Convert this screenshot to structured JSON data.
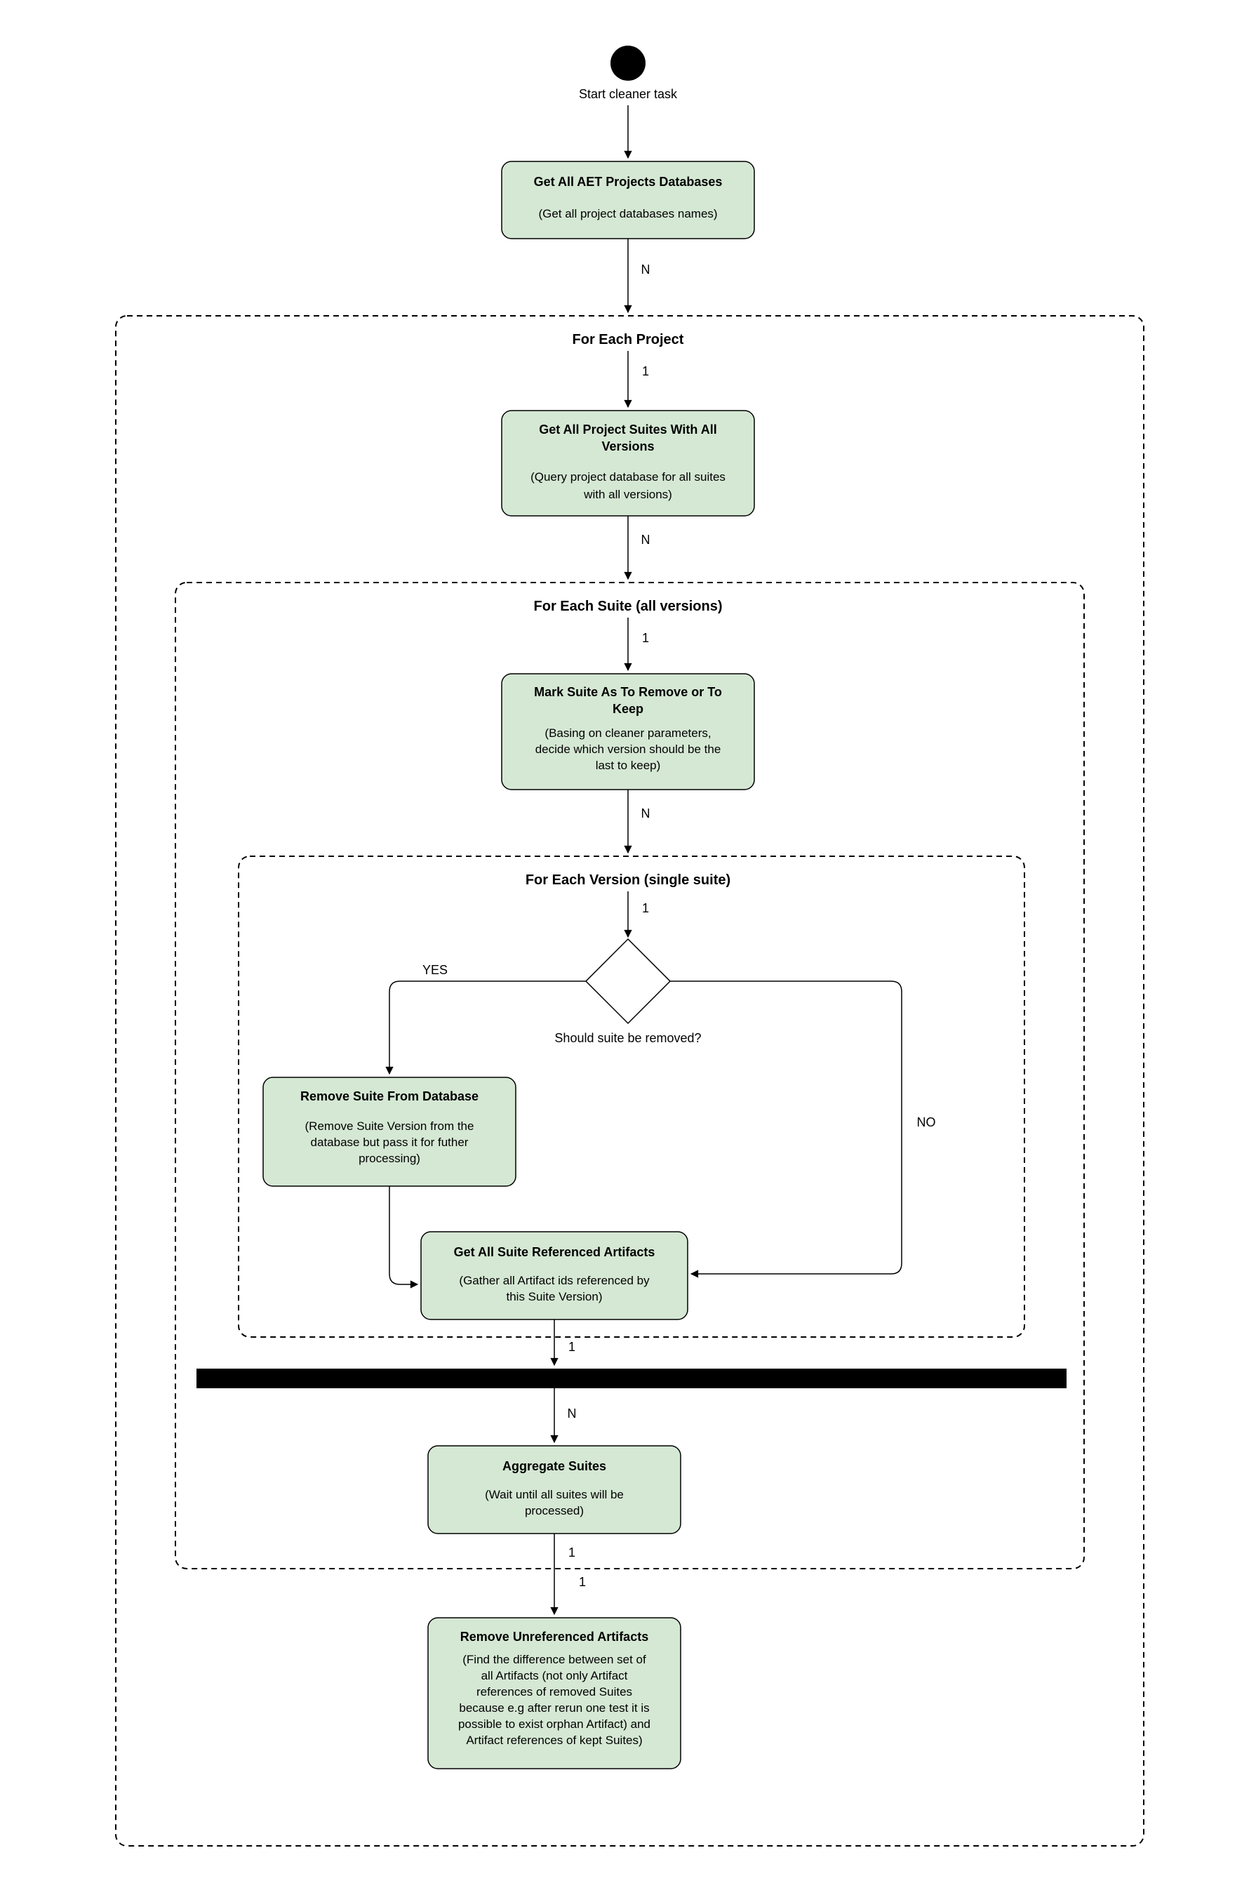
{
  "start_label": "Start cleaner task",
  "n1": {
    "title": "Get All AET Projects Databases",
    "desc": "(Get all project databases names)"
  },
  "region1_title": "For Each Project",
  "n2": {
    "title1": "Get All Project Suites With All",
    "title2": "Versions",
    "desc1": "(Query project database for all suites",
    "desc2": "with all versions)"
  },
  "region2_title": "For Each Suite (all versions)",
  "n3": {
    "title1": "Mark Suite As To Remove or To",
    "title2": "Keep",
    "desc1": "(Basing on cleaner parameters,",
    "desc2": "decide which version should be the",
    "desc3": "last to keep)"
  },
  "region3_title": "For Each Version (single suite)",
  "decision": "Should suite be removed?",
  "yes_label": "YES",
  "no_label": "NO",
  "n4": {
    "title": "Remove Suite From Database",
    "desc1": "(Remove Suite Version from the",
    "desc2": "database but pass it for futher",
    "desc3": "processing)"
  },
  "n5": {
    "title": "Get All Suite Referenced Artifacts",
    "desc1": "(Gather all Artifact ids referenced by",
    "desc2": "this Suite Version)"
  },
  "n6": {
    "title": "Aggregate Suites",
    "desc1": "(Wait until all suites will be",
    "desc2": "processed)"
  },
  "n7": {
    "title": "Remove Unreferenced Artifacts",
    "desc1": "(Find the difference between set of",
    "desc2": "all Artifacts (not only Artifact",
    "desc3": "references of removed Suites",
    "desc4": "because e.g after rerun one test it is",
    "desc5": "possible to exist orphan Artifact) and",
    "desc6": "Artifact references of kept Suites)"
  },
  "edge_N": "N",
  "edge_1": "1"
}
